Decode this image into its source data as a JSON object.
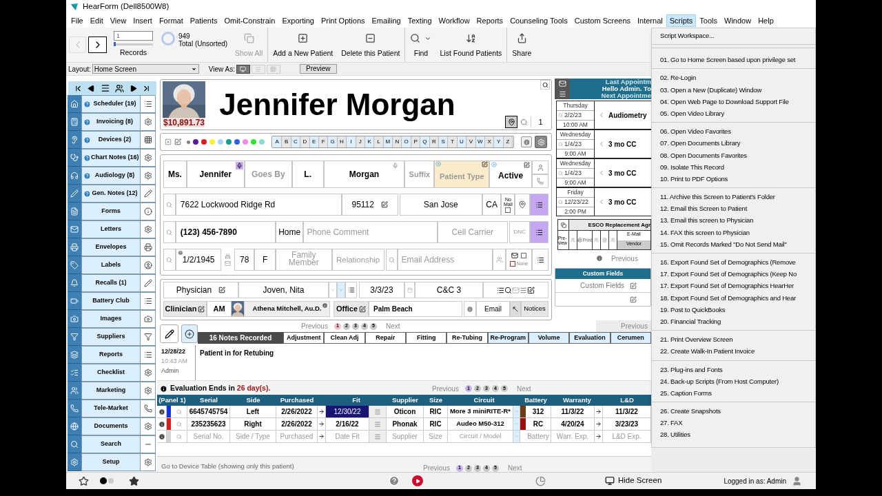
{
  "window": {
    "title": "HearForm (Dell8500W8)"
  },
  "record_slider": {
    "level": 0
  },
  "menu_bar": [
    {
      "label": "File",
      "selected": false
    },
    {
      "label": "Edit",
      "selected": false
    },
    {
      "label": "View",
      "selected": false
    },
    {
      "label": "Insert",
      "selected": false
    },
    {
      "label": "Format",
      "selected": false
    },
    {
      "label": "Patients",
      "selected": false
    },
    {
      "label": "Omit-Constrain",
      "selected": false
    },
    {
      "label": "Exporting",
      "selected": false
    },
    {
      "label": "Print Options",
      "selected": false
    },
    {
      "label": "Emailing",
      "selected": false
    },
    {
      "label": "Texting",
      "selected": false
    },
    {
      "label": "Workflow",
      "selected": false
    },
    {
      "label": "Reports",
      "selected": false
    },
    {
      "label": "Counseling Tools",
      "selected": false
    },
    {
      "label": "Custom Screens",
      "selected": false
    },
    {
      "label": "Internal",
      "selected": false
    },
    {
      "label": "Scripts",
      "selected": true
    },
    {
      "label": "Tools",
      "selected": false
    },
    {
      "label": "Window",
      "selected": false
    },
    {
      "label": "Help",
      "selected": false
    }
  ],
  "toolbar": {
    "back_disabled": true,
    "record": "1",
    "records_label": "Records",
    "total": "949",
    "total_label": "Total (Unsorted)",
    "groups": [
      [
        {
          "label": "Show All",
          "disabled": true,
          "has_menu": false
        }
      ],
      [
        {
          "label": "Add a New Patient",
          "disabled": false,
          "has_menu": false
        },
        {
          "label": "Delete this Patient",
          "disabled": false,
          "has_menu": false
        }
      ],
      [
        {
          "label": "Find",
          "disabled": false,
          "has_menu": true
        },
        {
          "label": "List Found Patients",
          "disabled": false,
          "has_menu": false
        }
      ],
      [
        {
          "label": "Share",
          "disabled": false,
          "has_menu": false
        }
      ]
    ]
  },
  "layout_bar": {
    "layout_label": "Layout:",
    "layout_value": "Home Screen",
    "view_as_label": "View As:",
    "view_as": [
      {
        "selected": true
      },
      {
        "selected": false
      },
      {
        "selected": false
      }
    ],
    "preview": "Preview"
  },
  "sidebar": {
    "items": [
      {
        "label": "Scheduler (19)",
        "help": true
      },
      {
        "label": "Invoicing (8)",
        "help": true
      },
      {
        "label": "Devices (2)",
        "help": true
      },
      {
        "label": "Chart Notes (16)",
        "help": true
      },
      {
        "label": "Audiology (8)",
        "help": true
      },
      {
        "label": "Gen. Notes (12)",
        "help": true
      },
      {
        "label": "Forms",
        "help": false
      },
      {
        "label": "Letters",
        "help": false
      },
      {
        "label": "Envelopes",
        "help": false
      },
      {
        "label": "Labels",
        "help": false
      },
      {
        "label": "Recalls (1)",
        "help": false
      },
      {
        "label": "Battery Club",
        "help": false
      },
      {
        "label": "Images",
        "help": false
      },
      {
        "label": "Suppliers",
        "help": false
      },
      {
        "label": "Reports",
        "help": false
      },
      {
        "label": "Checklist",
        "help": false
      },
      {
        "label": "Marketing",
        "help": false
      },
      {
        "label": "Tele-Market",
        "help": false
      },
      {
        "label": "Documents",
        "help": false
      },
      {
        "label": "Search",
        "help": false
      },
      {
        "label": "Setup",
        "help": false
      }
    ]
  },
  "patient": {
    "balance": "$10,891.73",
    "name": "Jennifer Morgan",
    "record_number": "1",
    "color_tags": [
      {
        "color": "#808080"
      },
      {
        "color": "#5b1a9e"
      },
      {
        "color": "#d62020"
      },
      {
        "color": "#f5f03a"
      },
      {
        "color": "#a8d2f0"
      },
      {
        "color": "#16a08c"
      },
      {
        "color": "#2f62d8"
      },
      {
        "color": "#f08ce0"
      },
      {
        "color": "#33e033"
      },
      {
        "color": "#8fd8cc"
      }
    ],
    "letters": [
      "A",
      "B",
      "C",
      "D",
      "E",
      "F",
      "G",
      "H",
      "I",
      "J",
      "K",
      "L",
      "M",
      "N",
      "O",
      "P",
      "Q",
      "R",
      "S",
      "T",
      "U",
      "V",
      "W",
      "X",
      "Y",
      "Z"
    ]
  },
  "demographics": {
    "title": "Ms.",
    "first": "Jennifer",
    "goes_by_placeholder": "Goes By",
    "middle": "L.",
    "last": "Morgan",
    "suffix_placeholder": "Suffix",
    "patient_type_placeholder": "Patient Type",
    "status": "Active",
    "address": "7622 Lockwood Ridge Rd",
    "zip": "95112",
    "city": "San Jose",
    "state": "CA",
    "no_mail_label": "No Mail",
    "no_mail": false,
    "phone": "(123) 456-7890",
    "phone_type": "Home",
    "phone_comment_placeholder": "Phone Comment",
    "cell_carrier_placeholder": "Cell Carrier",
    "dnc_label": "DNC",
    "birth_date": "1/2/1945",
    "age": "78",
    "sex": "F",
    "family_member_placeholder": "Family Member",
    "relationship_placeholder": "Relationship",
    "email_placeholder": "Email Address",
    "email_opt": false,
    "none_label": "None",
    "none_checked": false
  },
  "referral": {
    "physician_label": "Physician",
    "physician": "Joven, Nita",
    "date": "3/3/23",
    "code": "C&C 3",
    "clinician_label": "Clinician",
    "clinician_initials": "AM",
    "clinician": "Athena Mitchell, Au.D.",
    "office_label": "Office",
    "office": "Palm Beach",
    "email_button": "Email",
    "notices_button": "Notices"
  },
  "appointments_panel": {
    "last": "Last Appointm",
    "greeting": "Hello Admin. To",
    "next": "Next Appointme",
    "appointments": [
      {
        "day": "Thursday",
        "date": "2/2/23",
        "time": "10:00 AM",
        "type": "Audiometry"
      },
      {
        "day": "Wednesday",
        "date": "1/4/23",
        "time": "9:00 AM",
        "type": "3 mo CC"
      },
      {
        "day": "Wednesday",
        "date": "1/4/23",
        "time": "9:00 AM",
        "type": "3 mo CC"
      },
      {
        "day": "Friday",
        "date": "12/23/22",
        "time": "2:00 PM",
        "type": "3 mo CC"
      }
    ],
    "esco_title": "ESCO Replacement Agr",
    "preview": "Pre-view",
    "print": "Print",
    "email": "E-Mail",
    "vendor": "Vendor",
    "previous": "Previous"
  },
  "custom_fields": {
    "title": "Custom Fields",
    "field_label": "Custom Fields"
  },
  "notes": {
    "pagination": {
      "previous": "Previous",
      "pages": [
        {
          "label": "1",
          "selected": true
        },
        {
          "label": "2",
          "selected": false
        },
        {
          "label": "3",
          "selected": false
        },
        {
          "label": "4",
          "selected": false
        },
        {
          "label": "5",
          "selected": false
        }
      ],
      "next": "Next"
    },
    "side_previous": "Previous",
    "count": "16 Notes Recorded",
    "tabs": [
      {
        "label": "Adjustment",
        "highlighted": false
      },
      {
        "label": "Clean Adj",
        "highlighted": false
      },
      {
        "label": "Repair",
        "highlighted": false
      },
      {
        "label": "Fitting",
        "highlighted": false
      },
      {
        "label": "Re-Tubing",
        "highlighted": false
      },
      {
        "label": "Re-Program",
        "highlighted": true
      },
      {
        "label": "Volume",
        "highlighted": true
      },
      {
        "label": "Evaluation",
        "highlighted": true
      },
      {
        "label": "Cerumen",
        "highlighted": true
      }
    ],
    "entries": [
      {
        "date": "12/28/22",
        "time": "10:43 AM",
        "author": "Admin",
        "text": "Patient in for Retubing"
      }
    ]
  },
  "devices": {
    "evaluation_label": "Evaluation Ends in",
    "evaluation_days": "26 day(s).",
    "pagination": {
      "previous": "Previous",
      "pages": [
        {
          "label": "1",
          "selected": true
        },
        {
          "label": "2",
          "selected": false
        },
        {
          "label": "3",
          "selected": false
        },
        {
          "label": "4",
          "selected": false
        },
        {
          "label": "5",
          "selected": false
        }
      ],
      "next": "Next"
    },
    "columns": [
      "(Panel 1)",
      "Serial",
      "Side",
      "Purchased",
      "Fit",
      "Supplier",
      "Size",
      "Circuit",
      "Battery",
      "Warranty",
      "L&D"
    ],
    "rows": [
      {
        "kind": "device",
        "color": "#1436d8",
        "serial": "6645745754",
        "side": "Left",
        "purchased": "2/26/2022",
        "fit": "12/30/22",
        "fit_selected": true,
        "supplier": "Oticon",
        "size": "RIC",
        "circuit": "More 3 miniRITE-R*",
        "battery_tag": {
          "color": "#6b3d12"
        },
        "battery": "312",
        "warranty": "11/3/22",
        "ld": "11/3/22"
      },
      {
        "kind": "device",
        "color": "#d81e1e",
        "serial": "235235623",
        "side": "Right",
        "purchased": "2/26/2022",
        "fit": "2/16/22",
        "fit_selected": false,
        "supplier": "Phonak",
        "size": "RIC",
        "circuit": "Audeo M50-312",
        "battery_tag": {
          "color": "#9a0f0f"
        },
        "battery": "RC",
        "warranty": "4/20/24",
        "ld": "3/23/23"
      },
      {
        "kind": "placeholder",
        "color": "#d4d4d4",
        "serial": "Serial No.",
        "side": "Side / Type",
        "purchased": "Purchased",
        "fit": "Date Fit",
        "fit_selected": false,
        "supplier": "Supplier",
        "size": "Size",
        "circuit": "Circuit / Model",
        "battery": "Battery",
        "warranty": "Warr. Exp.",
        "ld": "L&D Exp."
      }
    ],
    "link": "Go to Device Table (showing only this patient)",
    "bottom_pagination": {
      "previous": "Previous",
      "pages": [
        {
          "label": "1",
          "selected": true
        },
        {
          "label": "2",
          "selected": false
        },
        {
          "label": "3",
          "selected": false
        },
        {
          "label": "4",
          "selected": false
        },
        {
          "label": "5",
          "selected": false
        }
      ],
      "next": "Next"
    }
  },
  "scripts_menu": {
    "groups": [
      [
        "Script Workspace..."
      ],
      [
        "01. Go to Home Screen based upon privilege set"
      ],
      [
        "02. Re-Login",
        "03. Open a New (Duplicate) Window",
        "04. Open Web Page to Download Support File",
        "05. Open Video Library"
      ],
      [
        "06. Open Video Favorites",
        "07. Open Documents Library",
        "08. Open Documents Favorites",
        "09. Isolate This Record",
        "10. Print to PDF Options"
      ],
      [
        "11. Archive this Screen to Patient's Folder",
        "12. Email this Screen to Patient",
        "13. Email this screen to Physician",
        "14. FAX this screen to Physician",
        "15. Omit Records Marked \"Do Not Send Mail\""
      ],
      [
        "16. Export Found Set of Demographics (Remove",
        "17. Export Found Set of Demographics (Keep No",
        "17. Export Found Set of Demographics HearHer",
        "18. Export Found Set of Demographics and Hear",
        "19. Post to QuickBooks",
        "20. Financial Tracking"
      ],
      [
        "21. Print Overview Screen",
        "22. Create Walk-In Patient Invoice"
      ],
      [
        "23. Plug-ins and Fonts",
        "24. Back-up Scripts (From Host Computer)",
        "25. Caption Forms"
      ],
      [
        "26. Create Snapshots",
        "27. FAX",
        "28. Utilities"
      ]
    ]
  },
  "status_bar": {
    "hide_screen": "Hide Screen",
    "logged_in": "Logged in as: Admin"
  }
}
